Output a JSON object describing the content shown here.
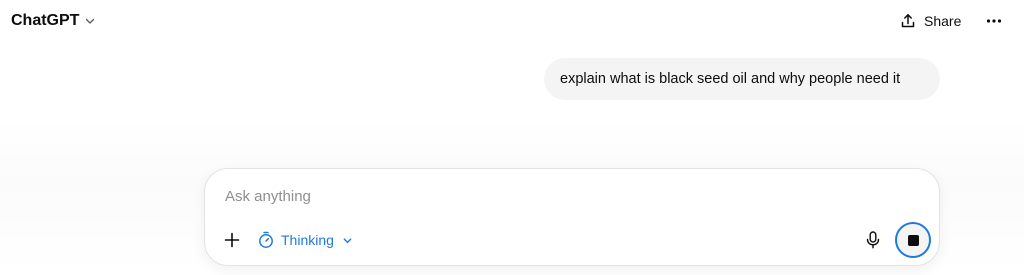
{
  "header": {
    "model_name": "ChatGPT",
    "share_label": "Share"
  },
  "conversation": {
    "messages": [
      {
        "role": "user",
        "text": "explain what is black seed oil and why people need it"
      }
    ]
  },
  "composer": {
    "placeholder": "Ask anything",
    "value": "",
    "mode_label": "Thinking"
  },
  "colors": {
    "accent": "#1f7ae0",
    "bubble_bg": "#f4f4f4",
    "text": "#0d0d0d",
    "placeholder": "#8e8e8e"
  },
  "icons": {
    "model_chevron": "chevron-down-icon",
    "share": "share-icon",
    "more": "more-options-icon",
    "attach": "plus-icon",
    "mode": "timer-icon",
    "mode_chevron": "chevron-down-icon",
    "voice": "microphone-icon",
    "stop": "stop-icon"
  }
}
